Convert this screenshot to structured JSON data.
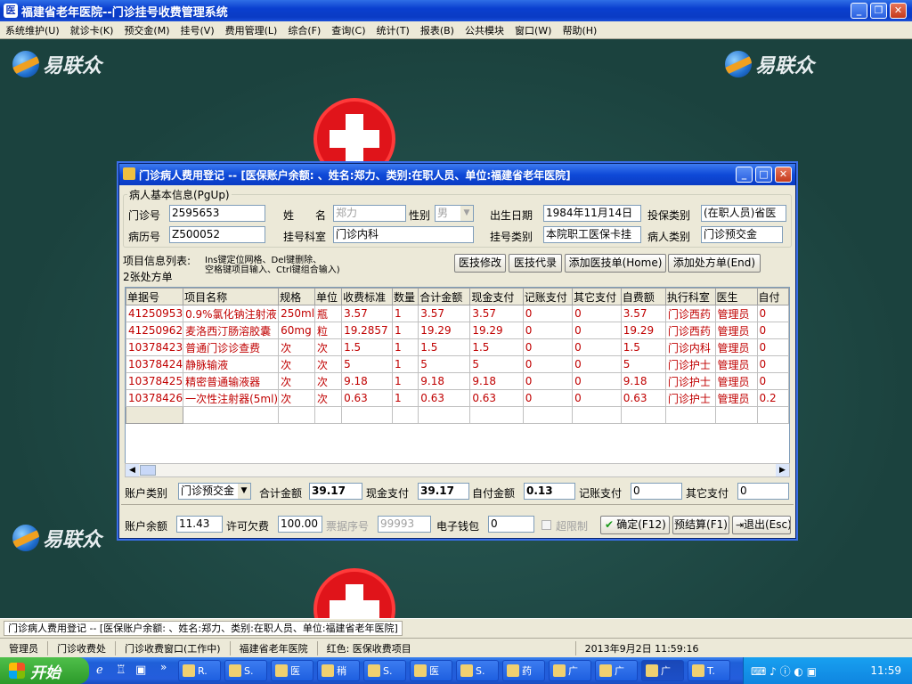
{
  "window": {
    "title": "福建省老年医院--门诊挂号收费管理系统",
    "app_icon": "医"
  },
  "menu": [
    "系统维护(U)",
    "就诊卡(K)",
    "预交金(M)",
    "挂号(V)",
    "费用管理(L)",
    "综合(F)",
    "查询(C)",
    "统计(T)",
    "报表(B)",
    "公共模块",
    "窗口(W)",
    "帮助(H)"
  ],
  "desktop": {
    "logo_text": "易联众"
  },
  "dialog": {
    "title": "门诊病人费用登记 -- [医保账户余额: 、姓名:郑力、类别:在职人员、单位:福建省老年医院]",
    "patient_group_label": "病人基本信息(PgUp)",
    "fields": {
      "clinic_no_label": "门诊号",
      "clinic_no": "2595653",
      "name_label": "姓　　名",
      "name": "郑力",
      "gender_label": "性别",
      "gender": "男",
      "birth_label": "出生日期",
      "birth": "1984年11月14日",
      "insurance_type_label": "投保类别",
      "insurance_type": "(在职人员)省医",
      "record_no_label": "病历号",
      "record_no": "Z500052",
      "dept_label": "挂号科室",
      "dept": "门诊内科",
      "reg_type_label": "挂号类别",
      "reg_type": "本院职工医保卡挂",
      "patient_type_label": "病人类别",
      "patient_type": "门诊预交金"
    },
    "list_label": "项目信息列表:",
    "hint_line1": "Ins键定位网格、Del键删除、",
    "hint_line2": "空格键项目输入、Ctrl键组合输入)",
    "rx_count": "2张处方单",
    "buttons": {
      "modify": "医技修改",
      "proxy": "医技代录",
      "add_tech": "添加医技单(Home)",
      "add_rx": "添加处方单(End)"
    },
    "columns": [
      "单据号",
      "项目名称",
      "规格",
      "单位",
      "收费标准",
      "数量",
      "合计金额",
      "现金支付",
      "记账支付",
      "其它支付",
      "自费额",
      "执行科室",
      "医生",
      "自付"
    ],
    "rows": [
      [
        "41250953",
        "0.9%氯化钠注射液",
        "250ml",
        "瓶",
        "3.57",
        "1",
        "3.57",
        "3.57",
        "0",
        "0",
        "3.57",
        "门诊西药",
        "管理员",
        "0"
      ],
      [
        "41250962",
        "麦洛西汀肠溶胶囊",
        "60mg",
        "粒",
        "19.2857",
        "1",
        "19.29",
        "19.29",
        "0",
        "0",
        "19.29",
        "门诊西药",
        "管理员",
        "0"
      ],
      [
        "10378423",
        "普通门诊诊查费",
        "次",
        "次",
        "1.5",
        "1",
        "1.5",
        "1.5",
        "0",
        "0",
        "1.5",
        "门诊内科",
        "管理员",
        "0"
      ],
      [
        "10378424",
        "静脉输液",
        "次",
        "次",
        "5",
        "1",
        "5",
        "5",
        "0",
        "0",
        "5",
        "门诊护士",
        "管理员",
        "0"
      ],
      [
        "10378425",
        "精密普通输液器",
        "次",
        "次",
        "9.18",
        "1",
        "9.18",
        "9.18",
        "0",
        "0",
        "9.18",
        "门诊护士",
        "管理员",
        "0"
      ],
      [
        "10378426",
        "一次性注射器(5ml)",
        "次",
        "次",
        "0.63",
        "1",
        "0.63",
        "0.63",
        "0",
        "0",
        "0.63",
        "门诊护士",
        "管理员",
        "0.2"
      ]
    ],
    "summary": {
      "acct_type_label": "账户类别",
      "acct_type": "门诊预交金",
      "total_label": "合计金额",
      "total": "39.17",
      "cash_label": "现金支付",
      "cash": "39.17",
      "self_label": "自付金额",
      "self": "0.13",
      "acct_pay_label": "记账支付",
      "acct_pay": "0",
      "other_label": "其它支付",
      "other": "0"
    },
    "bottom": {
      "balance_label": "账户余额",
      "balance": "11.43",
      "overdraft_label": "许可欠费",
      "overdraft": "100.00",
      "receipt_label": "票据序号",
      "receipt": "99993",
      "ewallet_label": "电子钱包",
      "ewallet": "0",
      "limit_label": "超限制",
      "ok": "确定(F12)",
      "presettle": "预结算(F1)",
      "exit": "退出(Esc)"
    }
  },
  "status1": "门诊病人费用登记 -- [医保账户余额: 、姓名:郑力、类别:在职人员、单位:福建省老年医院]",
  "status2": [
    "管理员",
    "门诊收费处",
    "门诊收费窗口(工作中)",
    "福建省老年医院",
    "红色: 医保收费项目"
  ],
  "status_datetime": "2013年9月2日  11:59:16",
  "taskbar": {
    "start": "开始",
    "tasks": [
      "R.",
      "S.",
      "医",
      "稍",
      "S.",
      "医",
      "S.",
      "药",
      "广",
      "广",
      "广",
      "T."
    ],
    "clock": "11:59"
  }
}
